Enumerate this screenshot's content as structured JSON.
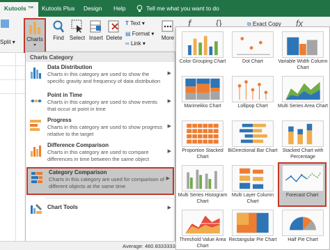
{
  "tabs": [
    "Kutools ™",
    "Kutools Plus",
    "Design",
    "Help"
  ],
  "tell_me": "Tell me what you want to do",
  "ribbon": {
    "split_label": "Split ▾",
    "charts_label": "Charts",
    "find_label": "Find",
    "select_label": "Select",
    "insert_label": "Insert",
    "delete_label": "Delete",
    "text_label": "Text ▾",
    "format_label": "Format ▾",
    "link_label": "Link ▾",
    "more_label": "More",
    "exact_copy_label": "Exact Copy"
  },
  "menu": {
    "header": "Charts Category",
    "items": [
      {
        "title": "Data Distribution",
        "desc": "Charts in this category are used to show the specific gravity and frequency of data distribution",
        "icon": "data-distribution-icon"
      },
      {
        "title": "Point in Time",
        "desc": "Charts in this category are used to show events that occur at point in time",
        "icon": "point-in-time-icon"
      },
      {
        "title": "Progress",
        "desc": "Charts in this category are used to show progress relative to the target",
        "icon": "progress-icon"
      },
      {
        "title": "Difference Comparison",
        "desc": "Charts in this category are used to compare differences in time between the same object",
        "icon": "difference-comparison-icon"
      },
      {
        "title": "Category Comparison",
        "desc": "Charts in this category are used for comparison of different objects at the same time",
        "icon": "category-comparison-icon"
      },
      {
        "title": "Chart Tools",
        "desc": "",
        "icon": "chart-tools-icon"
      }
    ]
  },
  "gallery": [
    "Color Grouping Chart",
    "Dot Chart",
    "Variable Width Column Chart",
    "Marimekko Chart",
    "Lollipop Chart",
    "Multi Series Area Chart",
    "Proportion Stacked Chart",
    "BiDirectional Bar Chart",
    "Stacked Chart with Percentage",
    "Multi Series Histogram Chart",
    "Multi Layer Column Chart",
    "Forecast Chart",
    "Threshold Value Area Chart",
    "Rectangular Pie Chart",
    "Half Pie Chart"
  ],
  "status": "Average: 460.8333333",
  "colors": {
    "excel_green": "#217346",
    "highlight_border": "#c0392b",
    "highlight_bg": "#c8c8c8"
  }
}
